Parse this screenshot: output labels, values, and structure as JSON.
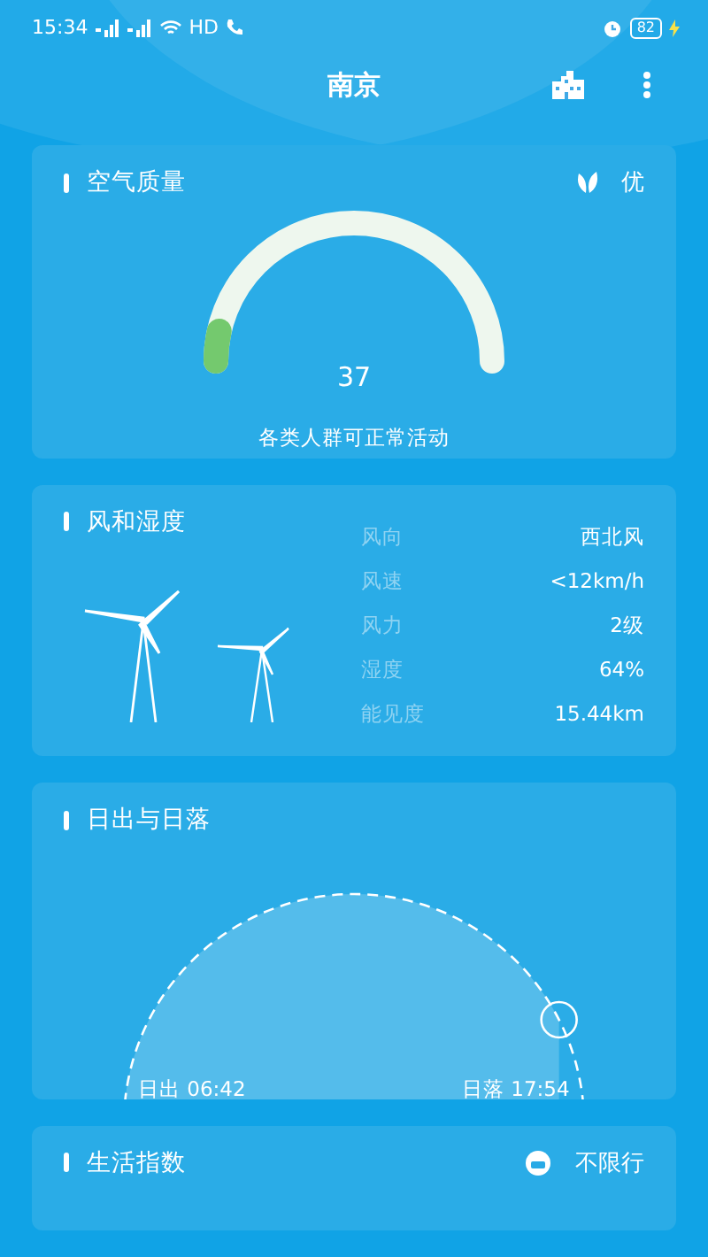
{
  "status_bar": {
    "time": "15:34",
    "hd": "HD",
    "battery": "82"
  },
  "header": {
    "city": "南京"
  },
  "air_quality": {
    "title": "空气质量",
    "grade": "优",
    "aqi": "37",
    "advice": "各类人群可正常活动"
  },
  "wind": {
    "title": "风和湿度",
    "rows": [
      {
        "label": "风向",
        "value": "西北风"
      },
      {
        "label": "风速",
        "value": "<12km/h"
      },
      {
        "label": "风力",
        "value": "2级"
      },
      {
        "label": "湿度",
        "value": "64%"
      },
      {
        "label": "能见度",
        "value": "15.44km"
      }
    ]
  },
  "sun": {
    "title": "日出与日落",
    "sunrise": "日出 06:42",
    "sunset": "日落 17:54"
  },
  "life": {
    "title": "生活指数",
    "traffic": "不限行"
  }
}
